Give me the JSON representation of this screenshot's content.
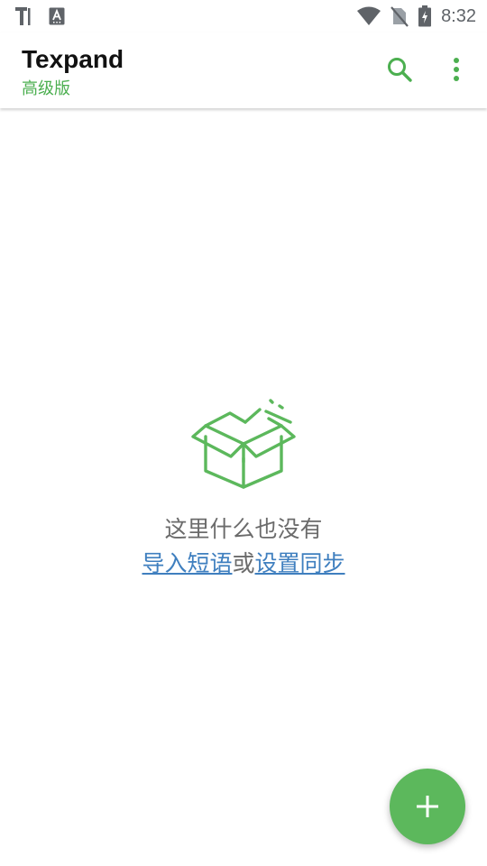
{
  "status_bar": {
    "time": "8:32",
    "left_icons": [
      "texpand-notification-icon",
      "accessibility-a-icon"
    ],
    "right_icons": [
      "wifi-icon",
      "no-sim-icon",
      "battery-charging-icon"
    ]
  },
  "app_bar": {
    "title": "Texpand",
    "subtitle": "高级版",
    "actions": [
      "search-icon",
      "more-vert-icon"
    ]
  },
  "empty_state": {
    "icon": "open-box-icon",
    "message": "这里什么也没有",
    "import_link": "导入短语",
    "connector": "或",
    "sync_link": "设置同步"
  },
  "fab": {
    "icon": "plus-icon"
  },
  "colors": {
    "accent_green": "#4caf50",
    "fab_green": "#5cb85c",
    "link_blue": "#3f7fbf",
    "text_gray": "#6b6b6b",
    "status_gray": "#5f6368"
  }
}
